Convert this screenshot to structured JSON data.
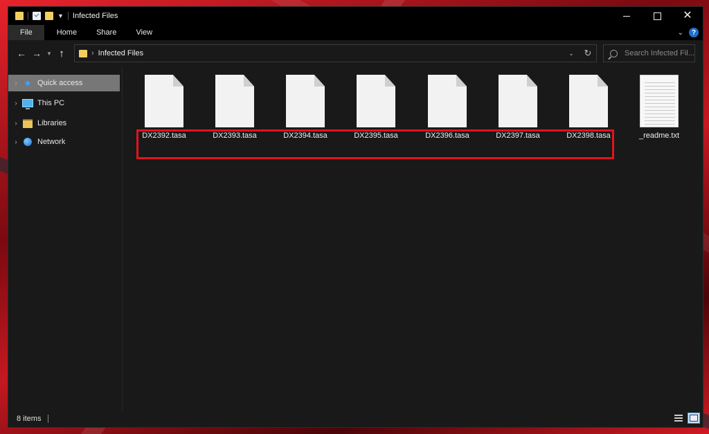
{
  "window": {
    "title": "Infected Files"
  },
  "ribbon": {
    "tabs": [
      {
        "label": "File"
      },
      {
        "label": "Home"
      },
      {
        "label": "Share"
      },
      {
        "label": "View"
      }
    ],
    "help": "?"
  },
  "navigation": {
    "address_path": "Infected Files",
    "search_placeholder": "Search Infected Fil..."
  },
  "sidebar": {
    "items": [
      {
        "label": "Quick access",
        "icon": "star-icon",
        "selected": true
      },
      {
        "label": "This PC",
        "icon": "computer-icon"
      },
      {
        "label": "Libraries",
        "icon": "libraries-icon"
      },
      {
        "label": "Network",
        "icon": "network-icon"
      }
    ]
  },
  "files": [
    {
      "name": "DX2392.tasa",
      "icon": "blank-file-icon"
    },
    {
      "name": "DX2393.tasa",
      "icon": "blank-file-icon"
    },
    {
      "name": "DX2394.tasa",
      "icon": "blank-file-icon"
    },
    {
      "name": "DX2395.tasa",
      "icon": "blank-file-icon"
    },
    {
      "name": "DX2396.tasa",
      "icon": "blank-file-icon"
    },
    {
      "name": "DX2397.tasa",
      "icon": "blank-file-icon"
    },
    {
      "name": "DX2398.tasa",
      "icon": "blank-file-icon"
    },
    {
      "name": "_readme.txt",
      "icon": "text-file-icon"
    }
  ],
  "status": {
    "item_count": "8 items"
  },
  "colors": {
    "highlight": "#e0141e",
    "window_bg": "#191919",
    "accent": "#1e6fd0"
  }
}
